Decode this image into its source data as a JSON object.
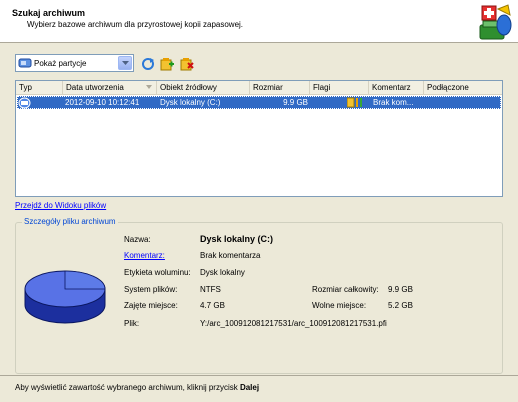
{
  "header": {
    "title": "Szukaj archiwum",
    "subtitle": "Wybierz bazowe archiwum dla przyrostowej kopii zapasowej."
  },
  "toolbar": {
    "view_combo_value": "Pokaż partycje"
  },
  "list": {
    "columns": [
      "Typ",
      "Data utworzenia",
      "Obiekt źródłowy",
      "Rozmiar",
      "Flagi",
      "Komentarz",
      "Podłączone"
    ],
    "rows": [
      {
        "date": "2012-09-10 10:12:41",
        "source": "Dysk lokalny (C:)",
        "size": "9.9 GB",
        "comment": "Brak kom...",
        "mounted": ""
      }
    ]
  },
  "link_view": "Przejdź do Widoku plików",
  "details": {
    "group_title": "Szczegóły pliku archiwum",
    "name_label": "Nazwa:",
    "name_value": "Dysk lokalny (C:)",
    "comment_label": "Komentarz:",
    "comment_value": "Brak komentarza",
    "volume_label_label": "Etykieta woluminu:",
    "volume_label_value": "Dysk lokalny",
    "fs_label": "System plików:",
    "fs_value": "NTFS",
    "total_size_label": "Rozmiar całkowity:",
    "total_size_value": "9.9 GB",
    "used_label": "Zajęte miejsce:",
    "used_value": "4.7 GB",
    "free_label": "Wolne miejsce:",
    "free_value": "5.2 GB",
    "file_label": "Plik:",
    "file_value": "Y:/arc_100912081217531/arc_100912081217531.pfi"
  },
  "footer": {
    "text_prefix": "Aby wyświetlić zawartość wybranego archiwum, kliknij przycisk ",
    "text_bold": "Dalej"
  },
  "colors": {
    "selection": "#316ac5",
    "window_bg": "#ece9d8",
    "link": "#0000ff",
    "group_title": "#0046d5"
  }
}
